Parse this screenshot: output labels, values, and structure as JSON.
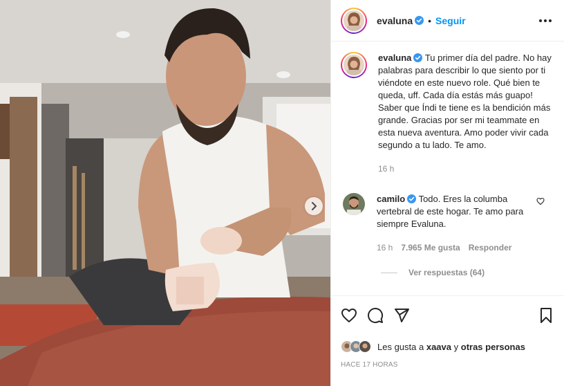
{
  "header": {
    "username": "evaluna",
    "separator": "•",
    "follow_label": "Seguir"
  },
  "caption": {
    "username": "evaluna",
    "text": "Tu primer día del padre. No hay palabras para describir lo que siento por ti viéndote en este nuevo role. Qué bien te queda, uff. Cada día estás más guapo! Saber que Índi te tiene es la bendición más grande. Gracias por ser mi teammate en esta nueva aventura. Amo poder vivir cada segundo a tu lado. Te amo.",
    "time": "16 h"
  },
  "comment": {
    "username": "camilo",
    "text": "Todo. Eres la columba vertebral de este hogar. Te amo para siempre Evaluna.",
    "time": "16 h",
    "likes": "7.965 Me gusta",
    "reply_label": "Responder",
    "view_replies": "Ver respuestas (64)"
  },
  "likes": {
    "prefix": "Les gusta a",
    "user": "xaava",
    "joiner": "y",
    "others": "otras personas"
  },
  "timestamp": "HACE 17 HORAS",
  "icons": {
    "like": "heart-icon",
    "comment": "comment-icon",
    "share": "paper-plane-icon",
    "save": "bookmark-icon",
    "next": "chevron-right-icon",
    "more": "more-options-icon",
    "verified": "verified-badge-icon"
  },
  "colors": {
    "accent": "#0095f6",
    "verified": "#3897f0",
    "muted": "#8e8e8e",
    "text": "#262626"
  }
}
